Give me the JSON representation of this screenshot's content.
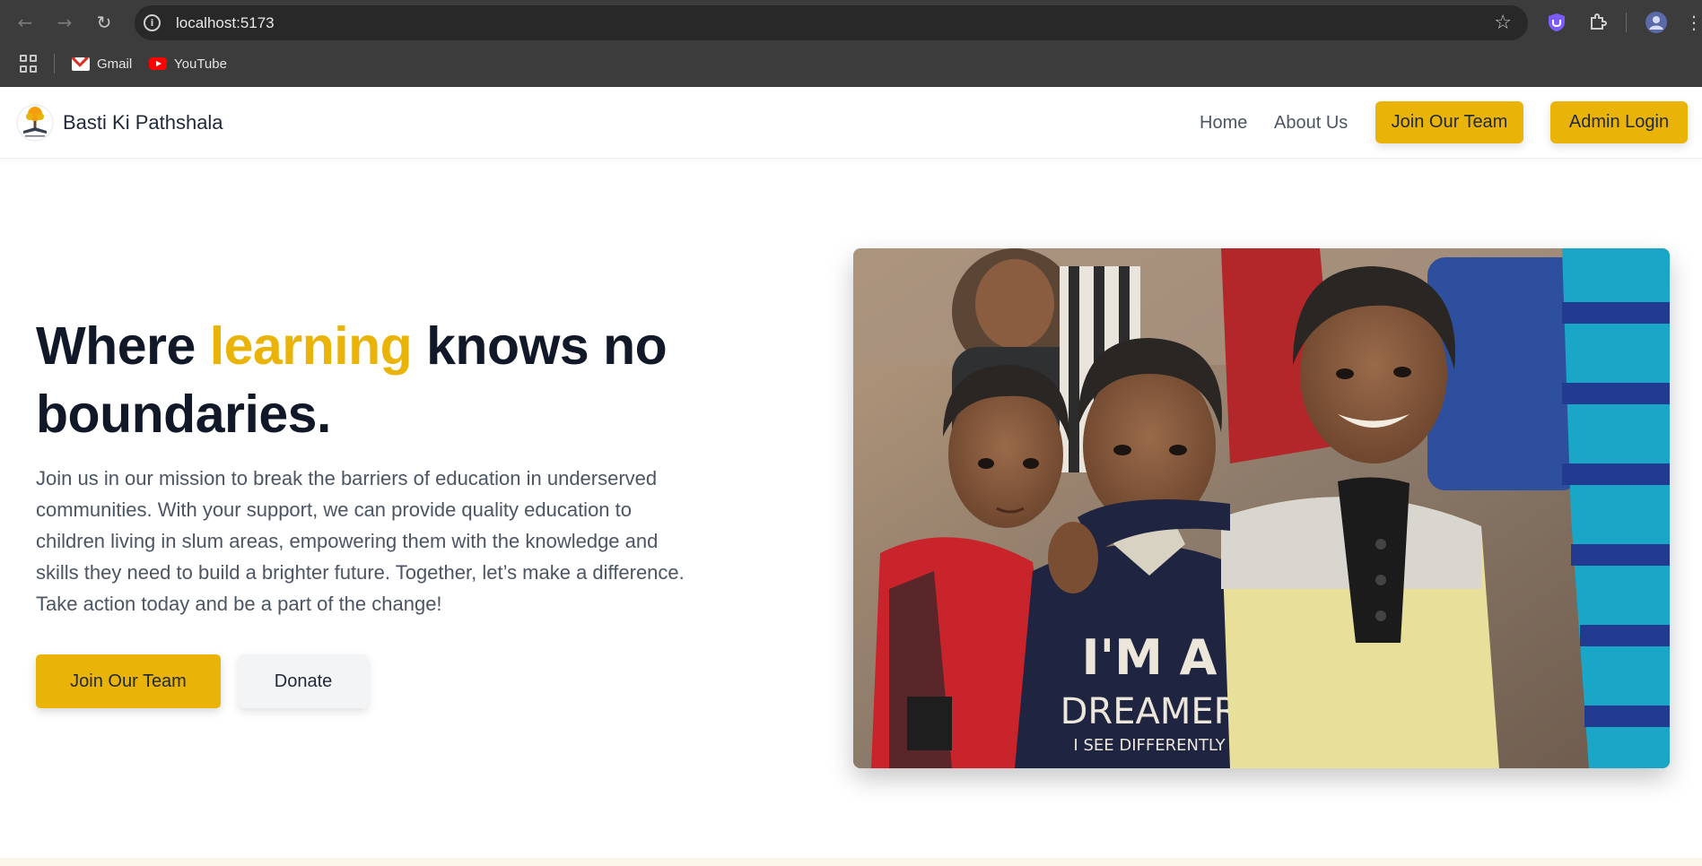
{
  "browser": {
    "url": "localhost:5173",
    "bookmarks": [
      {
        "label": "Gmail",
        "icon": "gmail-icon"
      },
      {
        "label": "YouTube",
        "icon": "youtube-icon"
      }
    ]
  },
  "header": {
    "brand_name": "Basti Ki Pathshala",
    "nav": {
      "home": "Home",
      "about": "About Us",
      "join": "Join Our Team",
      "admin": "Admin Login"
    }
  },
  "hero": {
    "title_part1": "Where ",
    "title_accent": "learning",
    "title_part2": " knows no boundaries.",
    "description": "Join us in our mission to break the barriers of education in underserved communities. With your support, we can provide quality education to children living in slum areas, empowering them with the knowledge and skills they need to build a brighter future. Together, let’s make a difference. Take action today and be a part of the change!",
    "cta_primary": "Join Our Team",
    "cta_secondary": "Donate",
    "photo_shirt_line1": "I'M A",
    "photo_shirt_line2": "DREAMER",
    "photo_shirt_line3": "I SEE DIFFERENTLY"
  },
  "colors": {
    "accent": "#eab308",
    "heading": "#111827",
    "body_text": "#4b5563",
    "chrome_bg": "#3c3c3c"
  }
}
